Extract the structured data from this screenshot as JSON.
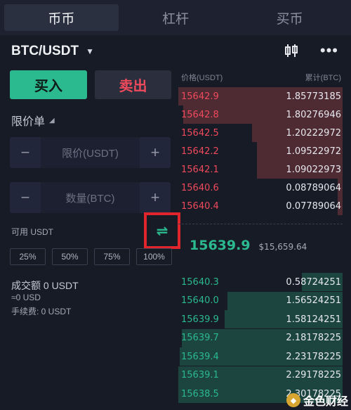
{
  "tabs": [
    "币币",
    "杠杆",
    "买币"
  ],
  "pair": "BTC/USDT",
  "actions": {
    "buy": "买入",
    "sell": "卖出"
  },
  "order_type": "限价单",
  "price_field": {
    "placeholder": "限价(USDT)",
    "minus": "−",
    "plus": "+"
  },
  "amount_field": {
    "placeholder": "数量(BTC)",
    "minus": "−",
    "plus": "+"
  },
  "available": "可用 USDT",
  "percents": [
    "25%",
    "50%",
    "75%",
    "100%"
  ],
  "volume": "成交额 0 USDT",
  "volume_usd": "≈0 USD",
  "fee": "手续费: 0 USDT",
  "orderbook": {
    "price_header": "价格(USDT)",
    "qty_header": "累计(BTC)",
    "asks": [
      {
        "price": "15642.9",
        "qty": "1.85773185",
        "depth": 1.0
      },
      {
        "price": "15642.8",
        "qty": "1.80276946",
        "depth": 0.97
      },
      {
        "price": "15642.5",
        "qty": "1.20222972",
        "depth": 0.55
      },
      {
        "price": "15642.2",
        "qty": "1.09522972",
        "depth": 0.52
      },
      {
        "price": "15642.1",
        "qty": "1.09022973",
        "depth": 0.52
      },
      {
        "price": "15640.6",
        "qty": "0.08789064",
        "depth": 0.03
      },
      {
        "price": "15640.4",
        "qty": "0.07789064",
        "depth": 0.03
      }
    ],
    "last_price": "15639.9",
    "last_fiat": "$15,659.64",
    "bids": [
      {
        "price": "15640.3",
        "qty": "0.58724251",
        "depth": 0.25
      },
      {
        "price": "15640.0",
        "qty": "1.56524251",
        "depth": 0.7
      },
      {
        "price": "15639.9",
        "qty": "1.58124251",
        "depth": 0.72
      },
      {
        "price": "15639.7",
        "qty": "2.18178225",
        "depth": 0.98
      },
      {
        "price": "15639.4",
        "qty": "2.23178225",
        "depth": 0.99
      },
      {
        "price": "15639.1",
        "qty": "2.29178225",
        "depth": 1.0
      },
      {
        "price": "15638.5",
        "qty": "2.30178225",
        "depth": 1.0
      }
    ]
  },
  "icons": {
    "candle": "candlestick-icon",
    "more": "more-icon",
    "swap": "swap-icon"
  },
  "colors": {
    "buy": "#2bb98f",
    "sell": "#f04a5c",
    "highlight": "#e0262c"
  },
  "watermark": "金色财经"
}
